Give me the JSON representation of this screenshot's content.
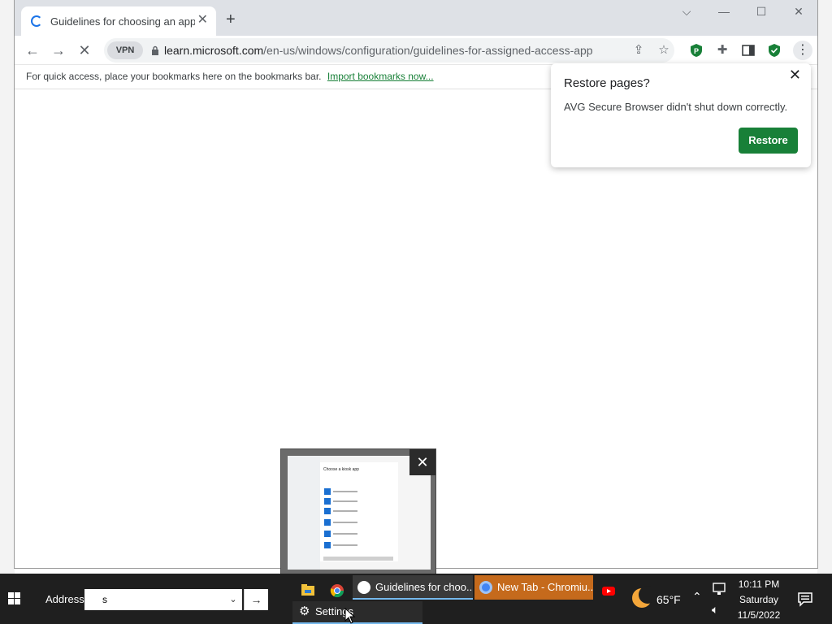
{
  "browser": {
    "tab_title": "Guidelines for choosing an app f",
    "url_host": "learn.microsoft.com",
    "url_path": "/en-us/windows/configuration/guidelines-for-assigned-access-app",
    "vpn_label": "VPN",
    "bookmarks_text": "For quick access, place your bookmarks here on the bookmarks bar.",
    "bookmarks_link": "Import bookmarks now..."
  },
  "restore_popup": {
    "title": "Restore pages?",
    "message": "AVG Secure Browser didn't shut down correctly.",
    "button": "Restore"
  },
  "taskbar": {
    "address_label": "Address",
    "address_value": "s",
    "tasks": [
      {
        "label": "Guidelines for choo..."
      },
      {
        "label": "New Tab - Chromiu..."
      },
      {
        "label": "Settings"
      }
    ],
    "weather_temp": "65°F",
    "clock_time": "10:11 PM",
    "clock_day": "Saturday",
    "clock_date": "11/5/2022"
  },
  "preview": {
    "heading": "Choose a kiosk app"
  },
  "colors": {
    "accent_green": "#188038",
    "taskbar_bg": "#1f1f1f",
    "newtab_task": "#c56a1c"
  }
}
